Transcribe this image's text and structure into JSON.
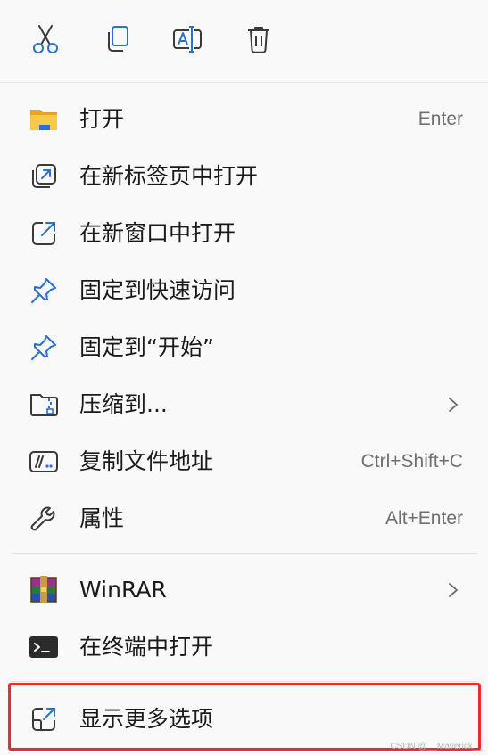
{
  "toolbar": {
    "buttons": [
      {
        "icon": "cut-icon"
      },
      {
        "icon": "copy-icon"
      },
      {
        "icon": "rename-icon"
      },
      {
        "icon": "delete-icon"
      }
    ]
  },
  "items": [
    {
      "label": "打开",
      "shortcut": "Enter",
      "icon": "folder-icon"
    },
    {
      "label": "在新标签页中打开",
      "shortcut": "",
      "icon": "new-tab-icon"
    },
    {
      "label": "在新窗口中打开",
      "shortcut": "",
      "icon": "new-window-icon"
    },
    {
      "label": "固定到快速访问",
      "shortcut": "",
      "icon": "pin-icon"
    },
    {
      "label": "固定到“开始”",
      "shortcut": "",
      "icon": "pin-icon"
    },
    {
      "label": "压缩到...",
      "shortcut": "",
      "icon": "zip-folder-icon",
      "submenu": true
    },
    {
      "label": "复制文件地址",
      "shortcut": "Ctrl+Shift+C",
      "icon": "copy-path-icon"
    },
    {
      "label": "属性",
      "shortcut": "Alt+Enter",
      "icon": "wrench-icon"
    },
    {
      "label": "WinRAR",
      "shortcut": "",
      "icon": "winrar-icon",
      "submenu": true
    },
    {
      "label": "在终端中打开",
      "shortcut": "",
      "icon": "terminal-icon"
    },
    {
      "label": "显示更多选项",
      "shortcut": "",
      "icon": "more-options-icon"
    }
  ],
  "watermark": "CSDN @__Maverick__",
  "colors": {
    "accent": "#2a6fd6",
    "highlight_border": "#ee2a2a"
  }
}
